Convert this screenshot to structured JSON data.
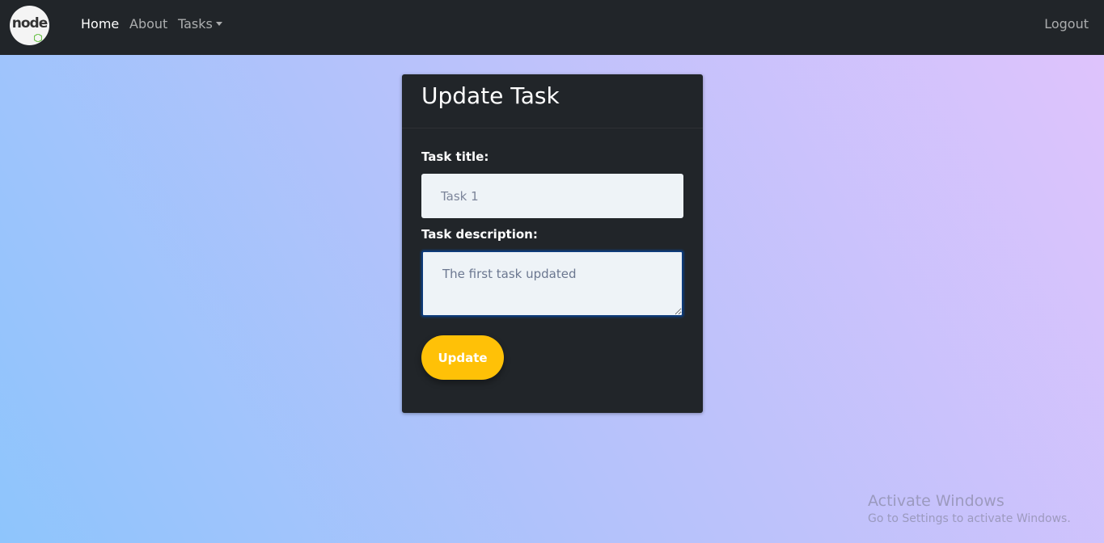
{
  "navbar": {
    "logo_text": "node",
    "links": {
      "home": "Home",
      "about": "About",
      "tasks": "Tasks"
    },
    "logout": "Logout"
  },
  "form": {
    "heading": "Update Task",
    "title_label": "Task title:",
    "title_placeholder": "Task 1",
    "title_value": "",
    "description_label": "Task description:",
    "description_value": "The first task updated",
    "submit_label": "Update"
  },
  "watermark": {
    "title": "Activate Windows",
    "subtitle": "Go to Settings to activate Windows."
  },
  "colors": {
    "navbar_bg": "#212529",
    "card_bg": "#212529",
    "button_bg": "#ffc107",
    "gradient_start": "#8ec5fc",
    "gradient_end": "#e0c3fc"
  }
}
